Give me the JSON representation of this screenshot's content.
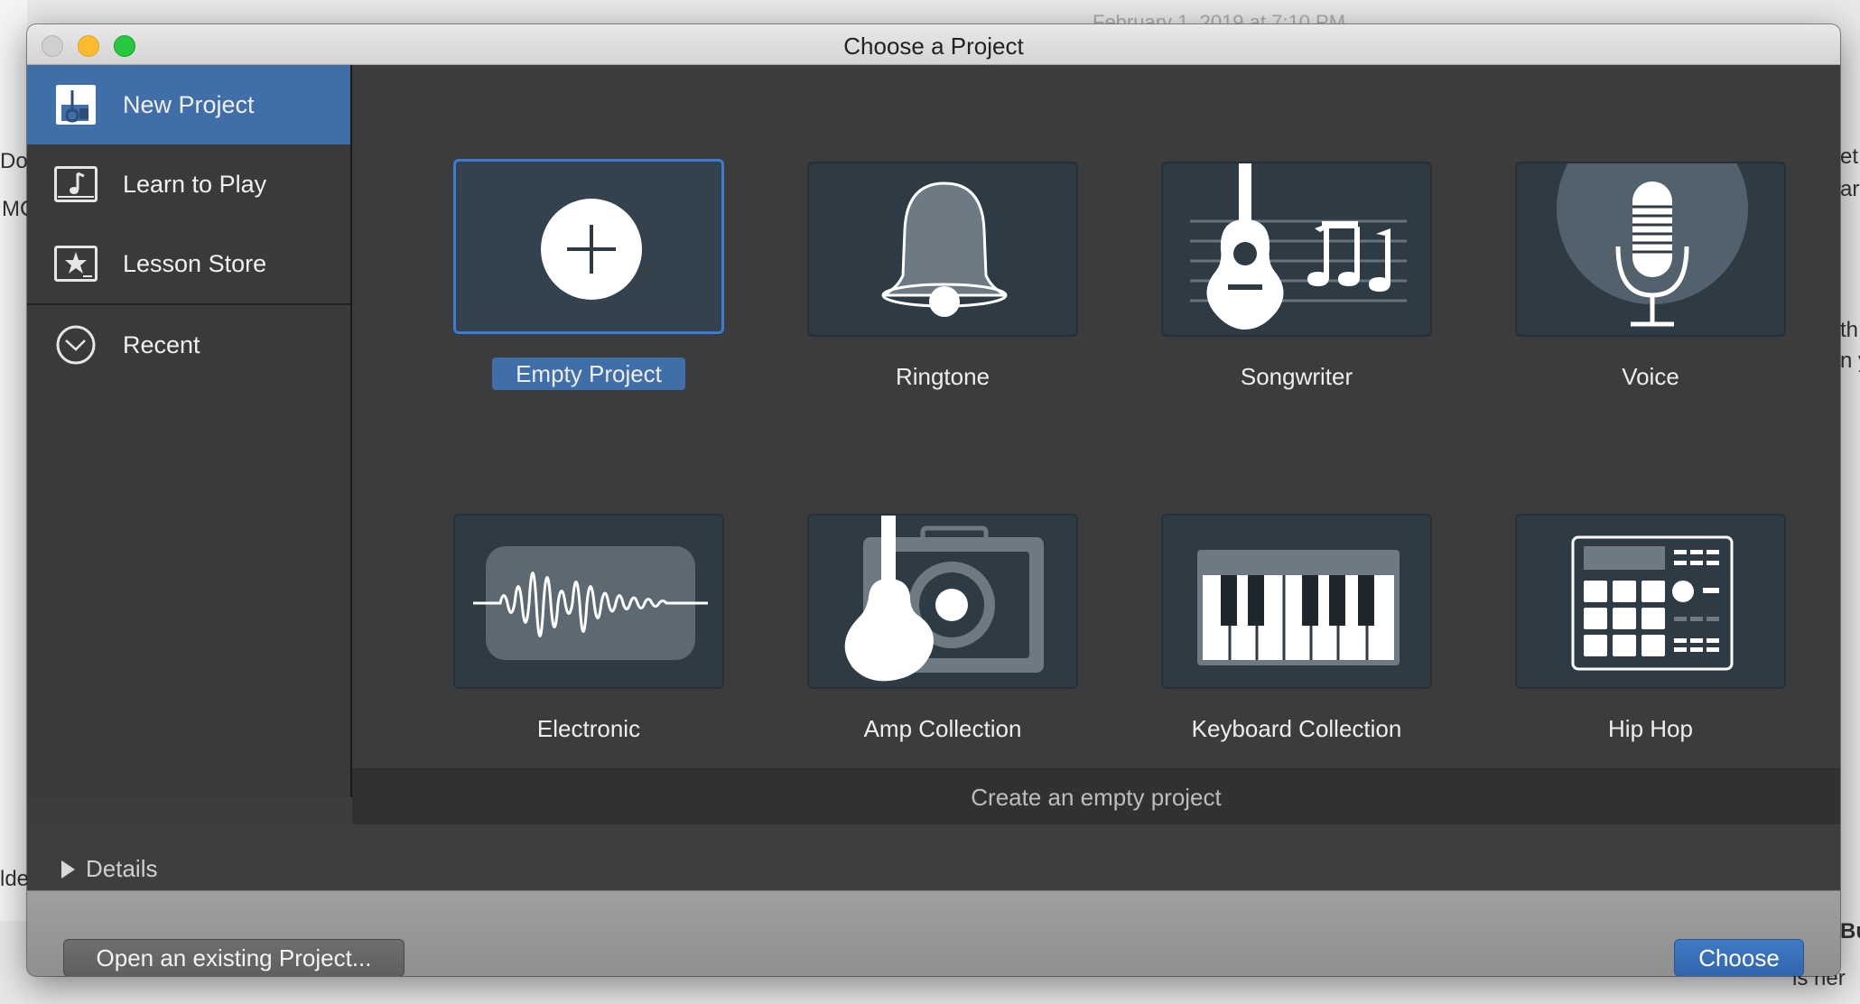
{
  "window": {
    "title": "Choose a Project"
  },
  "background": {
    "date_fragment": "February 1, 2019 at 7:10 PM",
    "left_fragments": [
      "Do",
      "MC",
      "lde"
    ],
    "right_fragments": [
      "et",
      "ard",
      "th",
      "n y",
      "Bu",
      "is ner"
    ]
  },
  "sidebar": {
    "items": [
      {
        "label": "New Project",
        "icon": "new-project-icon",
        "selected": true
      },
      {
        "label": "Learn to Play",
        "icon": "music-note-icon",
        "selected": false
      },
      {
        "label": "Lesson Store",
        "icon": "star-icon",
        "selected": false
      },
      {
        "label": "Recent",
        "icon": "clock-icon",
        "selected": false
      }
    ]
  },
  "templates": [
    {
      "label": "Empty Project",
      "icon": "plus-circle-icon",
      "selected": true
    },
    {
      "label": "Ringtone",
      "icon": "bell-icon",
      "selected": false
    },
    {
      "label": "Songwriter",
      "icon": "guitar-notes-icon",
      "selected": false
    },
    {
      "label": "Voice",
      "icon": "microphone-icon",
      "selected": false
    },
    {
      "label": "Electronic",
      "icon": "waveform-icon",
      "selected": false
    },
    {
      "label": "Amp Collection",
      "icon": "guitar-amp-icon",
      "selected": false
    },
    {
      "label": "Keyboard Collection",
      "icon": "keyboard-icon",
      "selected": false
    },
    {
      "label": "Hip Hop",
      "icon": "drum-machine-icon",
      "selected": false
    }
  ],
  "status": {
    "description": "Create an empty project"
  },
  "details": {
    "label": "Details"
  },
  "buttons": {
    "open_existing": "Open an existing Project...",
    "choose": "Choose"
  },
  "colors": {
    "accent": "#3f6ea8",
    "tile_bg": "#2f3b44",
    "window_bg": "#3d3d3d"
  }
}
